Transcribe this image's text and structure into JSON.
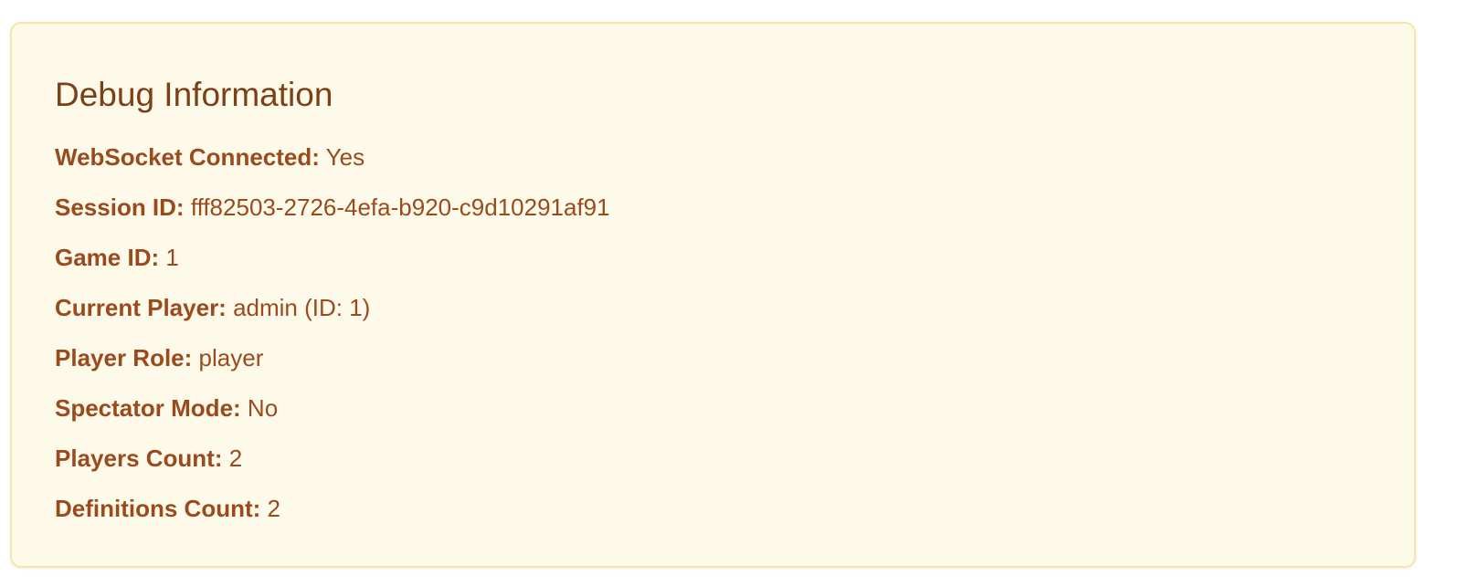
{
  "panel": {
    "title": "Debug Information",
    "rows": [
      {
        "label": "WebSocket Connected:",
        "value": "Yes"
      },
      {
        "label": "Session ID:",
        "value": "fff82503-2726-4efa-b920-c9d10291af91"
      },
      {
        "label": "Game ID:",
        "value": "1"
      },
      {
        "label": "Current Player:",
        "value": "admin (ID: 1)"
      },
      {
        "label": "Player Role:",
        "value": "player"
      },
      {
        "label": "Spectator Mode:",
        "value": "No"
      },
      {
        "label": "Players Count:",
        "value": "2"
      },
      {
        "label": "Definitions Count:",
        "value": "2"
      }
    ]
  },
  "colors": {
    "panel_background": "#fefaea",
    "panel_border": "#f7e6a6",
    "title_text": "#7c3f16",
    "body_text": "#9a4a1d"
  }
}
